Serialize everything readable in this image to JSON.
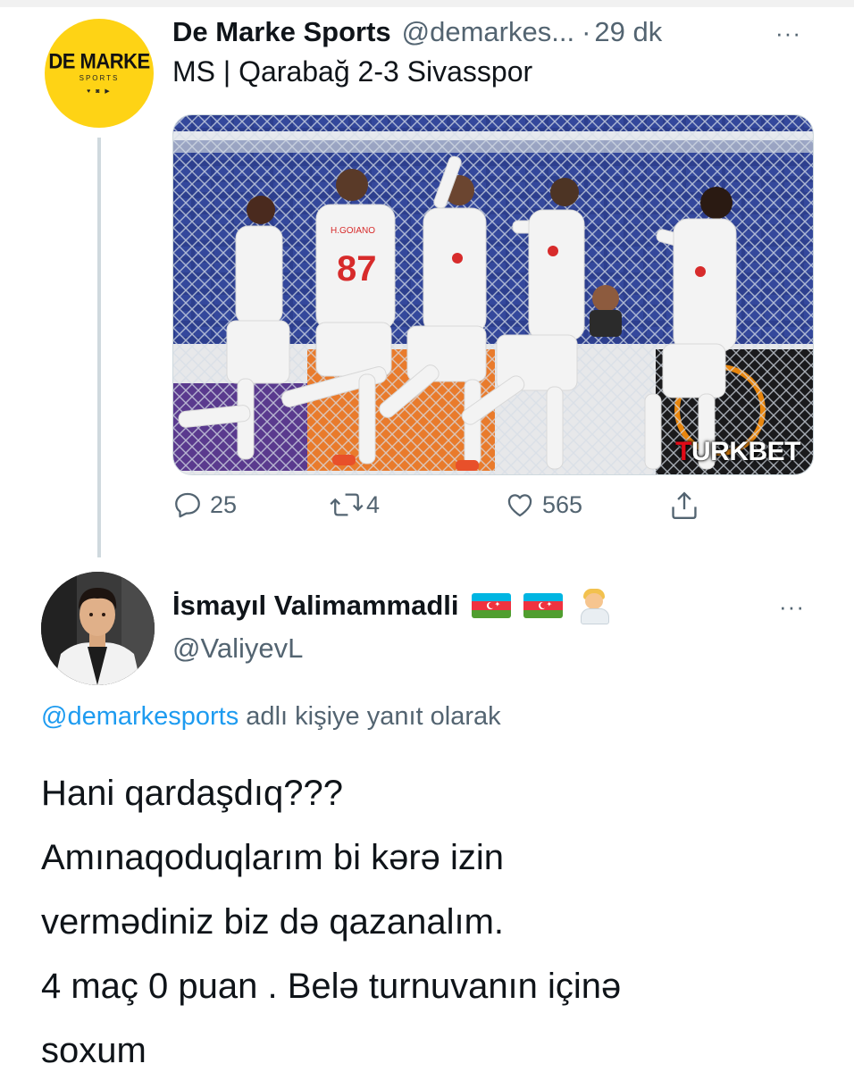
{
  "tweet1": {
    "avatar": {
      "logo_main": "DE MARKE",
      "logo_sub": "SPORTS",
      "logo_icons": "♥ ◙ ▶",
      "bg_color": "#fed315"
    },
    "display_name": "De Marke Sports",
    "handle": "@demarkes...",
    "separator": "·",
    "time": "29 dk",
    "more_icon": "···",
    "text": "MS | Qarabağ 2-3 Sivasspor",
    "media": {
      "description_icon": "match-photo",
      "player_number": "87",
      "player_name": "H.GOIANO",
      "watermark_red": "T",
      "watermark_rest_a": "URK",
      "watermark_rest_b": "BET"
    },
    "actions": {
      "replies": "25",
      "retweets": "4",
      "likes": "565"
    }
  },
  "tweet2": {
    "display_name": "İsmayıl Valimammadli",
    "flags": [
      "azerbaijan-flag",
      "azerbaijan-flag"
    ],
    "emoji": "man-health-worker-emoji",
    "handle": "@ValiyevL",
    "more_icon": "···",
    "reply_mention": "@demarkesports",
    "reply_suffix": " adlı kişiye yanıt olarak",
    "body_lines": [
      "Hani qardaşdıq???",
      "Amınaqoduqlarım bi kərə izin",
      "verməd iniz biz də qazanalım.",
      "4 maç 0 puan . Belə turnuvanın içinə",
      "soxum"
    ]
  },
  "colors": {
    "text_primary": "#0f1419",
    "text_secondary": "#536471",
    "link": "#1d9bf0",
    "thread_line": "#cfd9de"
  }
}
